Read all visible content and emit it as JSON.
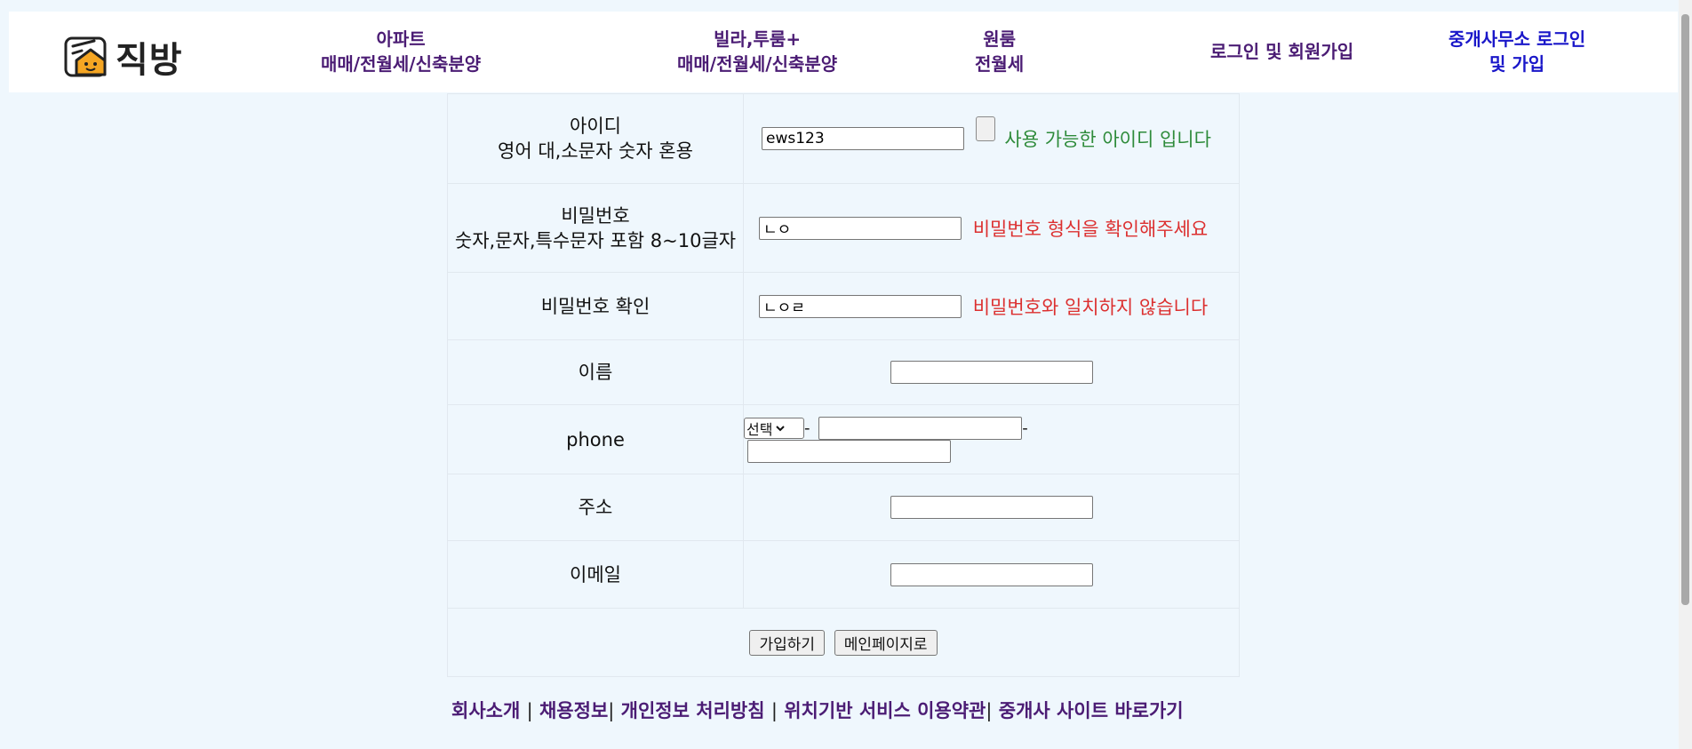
{
  "header": {
    "logo_text": "직방",
    "nav": [
      {
        "line1": "아파트",
        "line2": "매매/전월세/신축분양"
      },
      {
        "line1": "빌라,투룸+",
        "line2": "매매/전월세/신축분양"
      },
      {
        "line1": "원룸",
        "line2": "전월세"
      },
      {
        "line1": "로그인 및 회원가입",
        "line2": ""
      },
      {
        "line1": "중개사무소 로그인",
        "line2": "및 가입"
      }
    ]
  },
  "form": {
    "id": {
      "label1": "아이디",
      "label2": "영어 대,소문자 숫자 혼용",
      "value": "ews123",
      "message": "사용 가능한 아이디 입니다"
    },
    "password": {
      "label1": "비밀번호",
      "label2": "숫자,문자,특수문자 포함 8~10글자",
      "value": "ㄴㅇ",
      "message": "비밀번호 형식을 확인해주세요"
    },
    "password_confirm": {
      "label": "비밀번호 확인",
      "value": "ㄴㅇㄹ",
      "message": "비밀번호와 일치하지 않습니다"
    },
    "name": {
      "label": "이름",
      "value": ""
    },
    "phone": {
      "label": "phone",
      "select_value": "선택",
      "sep": "-"
    },
    "address": {
      "label": "주소",
      "value": ""
    },
    "email": {
      "label": "이메일",
      "value": ""
    },
    "buttons": {
      "signup": "가입하기",
      "main": "메인페이지로"
    }
  },
  "footer": {
    "links": [
      "회사소개",
      "채용정보",
      "개인정보 처리방침",
      "위치기반 서비스 이용약관",
      "중개사 사이트 바로가기"
    ],
    "separator": "|"
  },
  "colors": {
    "background": "#eff7fd",
    "nav_purple": "#4b1c74",
    "nav_blue": "#1a17c9",
    "ok_green": "#2e8b3a",
    "error_red": "#dc3030",
    "logo_orange": "#f5a623"
  }
}
